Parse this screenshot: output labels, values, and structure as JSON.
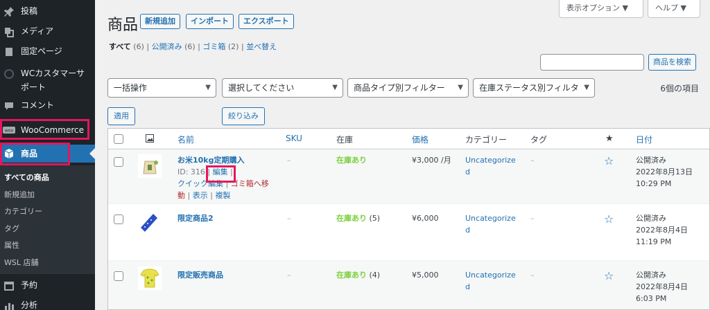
{
  "sidebar": {
    "items": [
      {
        "label": "投稿",
        "icon": "pin-icon"
      },
      {
        "label": "メディア",
        "icon": "media-icon"
      },
      {
        "label": "固定ページ",
        "icon": "page-icon"
      },
      {
        "label": "WCカスタマーサ",
        "label2": "ポート",
        "icon": "support-icon"
      },
      {
        "label": "コメント",
        "icon": "comment-icon"
      },
      {
        "label": "WooCommerce",
        "icon": "woo-icon"
      },
      {
        "label": "商品",
        "icon": "product-icon"
      },
      {
        "label": "予約",
        "icon": "calendar-icon"
      },
      {
        "label": "分析",
        "icon": "chart-icon"
      }
    ],
    "submenu": [
      "すべての商品",
      "新規追加",
      "カテゴリー",
      "タグ",
      "属性",
      "WSL 店舗"
    ]
  },
  "header": {
    "title": "商品",
    "buttons": [
      "新規追加",
      "インポート",
      "エクスポート"
    ],
    "screen_options": "表示オプション ▼",
    "help": "ヘルプ ▼"
  },
  "views": {
    "all": "すべて",
    "all_count": "(6)",
    "published": "公開済み",
    "published_count": "(6)",
    "trash": "ゴミ箱",
    "trash_count": "(2)",
    "sort": "並べ替え"
  },
  "search": {
    "button": "商品を検索",
    "value": ""
  },
  "filters": {
    "bulk": "一括操作",
    "category": "選択してください",
    "type": "商品タイプ別フィルター",
    "stock": "在庫ステータス別フィルタ",
    "apply": "適用",
    "filter": "絞り込み",
    "count": "6個の項目"
  },
  "table": {
    "headers": {
      "name": "名前",
      "sku": "SKU",
      "stock": "在庫",
      "price": "価格",
      "category": "カテゴリー",
      "tags": "タグ",
      "date": "日付"
    },
    "rows": [
      {
        "name": "お米10kg定期購入",
        "id": "ID: 316",
        "edit": "編集",
        "quick": "クイック編集",
        "trash1": "ゴミ箱へ移",
        "trash2": "動",
        "view": "表示",
        "dup": "複製",
        "sku": "–",
        "stock": "在庫あり",
        "stock_qty": "",
        "price": "¥3,000 /月",
        "category1": "Uncategorize",
        "category2": "d",
        "tags": "–",
        "status": "公開済み",
        "date": "2022年8月13日",
        "time": "10:29 PM"
      },
      {
        "name": "限定商品2",
        "sku": "–",
        "stock": "在庫あり",
        "stock_qty": "(5)",
        "price": "¥6,000",
        "category1": "Uncategorize",
        "category2": "d",
        "tags": "–",
        "status": "公開済み",
        "date": "2022年8月4日",
        "time": "11:19 PM"
      },
      {
        "name": "限定販売商品",
        "sku": "–",
        "stock": "在庫あり",
        "stock_qty": "(4)",
        "price": "¥5,000",
        "category1": "Uncategorize",
        "category2": "d",
        "tags": "–",
        "status": "公開済み",
        "date": "2022年8月4日",
        "time": "6:03 PM"
      }
    ]
  },
  "colors": {
    "accent": "#2271b1",
    "highlight": "#e3175b",
    "instock": "#7ad03a",
    "sidebar": "#1d2327"
  }
}
